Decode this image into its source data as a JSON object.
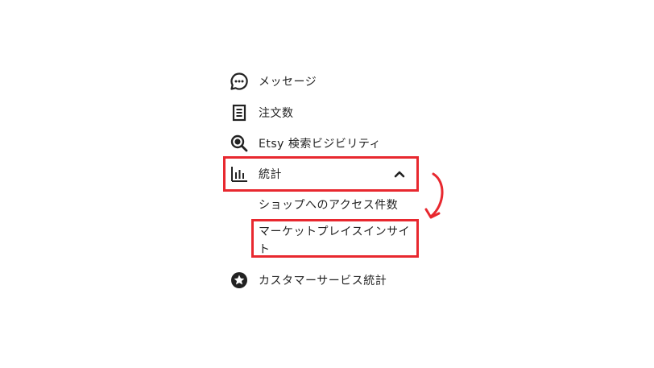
{
  "menu": {
    "messages": {
      "label": "メッセージ",
      "icon": "chat-bubble-icon"
    },
    "orders": {
      "label": "注文数",
      "icon": "document-icon"
    },
    "etsy_search": {
      "label": "Etsy 検索ビジビリティ",
      "icon": "search-icon"
    },
    "stats": {
      "label": "統計",
      "icon": "bar-chart-icon",
      "expanded": true,
      "sub_items": [
        {
          "label": "ショップへのアクセス件数"
        },
        {
          "label_line1": "マーケットプレイスインサイ",
          "label_line2": "ト"
        }
      ]
    },
    "customer_service": {
      "label": "カスタマーサービス統計",
      "icon": "star-badge-icon"
    }
  },
  "colors": {
    "highlight": "#e8282f",
    "text": "#222222",
    "icon": "#222222"
  }
}
